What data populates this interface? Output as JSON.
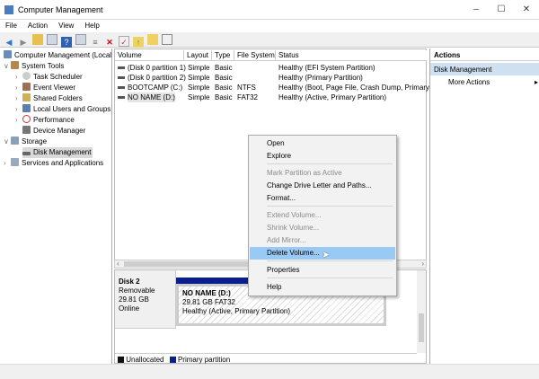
{
  "window": {
    "title": "Computer Management"
  },
  "menu": [
    "File",
    "Action",
    "View",
    "Help"
  ],
  "tree": [
    {
      "label": "Computer Management (Local",
      "level": 0
    },
    {
      "label": "System Tools",
      "level": 1,
      "expanded": true
    },
    {
      "label": "Task Scheduler",
      "level": 2
    },
    {
      "label": "Event Viewer",
      "level": 2
    },
    {
      "label": "Shared Folders",
      "level": 2
    },
    {
      "label": "Local Users and Groups",
      "level": 2
    },
    {
      "label": "Performance",
      "level": 2
    },
    {
      "label": "Device Manager",
      "level": 2
    },
    {
      "label": "Storage",
      "level": 1,
      "expanded": true
    },
    {
      "label": "Disk Management",
      "level": 2,
      "selected": true
    },
    {
      "label": "Services and Applications",
      "level": 1
    }
  ],
  "volumes": {
    "headers": [
      "Volume",
      "Layout",
      "Type",
      "File System",
      "Status"
    ],
    "rows": [
      [
        "(Disk 0 partition 1)",
        "Simple",
        "Basic",
        "",
        "Healthy (EFI System Partition)"
      ],
      [
        "(Disk 0 partition 2)",
        "Simple",
        "Basic",
        "",
        "Healthy (Primary Partition)"
      ],
      [
        "BOOTCAMP (C:)",
        "Simple",
        "Basic",
        "NTFS",
        "Healthy (Boot, Page File, Crash Dump, Primary P"
      ],
      [
        "NO NAME (D:)",
        "Simple",
        "Basic",
        "FAT32",
        "Healthy (Active, Primary Partition)"
      ]
    ]
  },
  "disk": {
    "name": "Disk 2",
    "type": "Removable",
    "size": "29.81 GB",
    "state": "Online",
    "partition": {
      "name": "NO NAME  (D:)",
      "detail": "29.81 GB FAT32",
      "status": "Healthy (Active, Primary Partition)"
    }
  },
  "legend": [
    {
      "label": "Unallocated",
      "color": "#111111"
    },
    {
      "label": "Primary partition",
      "color": "#0a1f8f"
    }
  ],
  "actions": {
    "title": "Actions",
    "section": "Disk Management",
    "items": [
      "More Actions"
    ]
  },
  "context_menu": [
    {
      "label": "Open"
    },
    {
      "label": "Explore"
    },
    {
      "label": "Mark Partition as Active",
      "disabled": true
    },
    {
      "label": "Change Drive Letter and Paths..."
    },
    {
      "label": "Format..."
    },
    {
      "label": "Extend Volume...",
      "disabled": true
    },
    {
      "label": "Shrink Volume...",
      "disabled": true
    },
    {
      "label": "Add Mirror...",
      "disabled": true
    },
    {
      "label": "Delete Volume...",
      "highlighted": true
    },
    {
      "label": "Properties"
    },
    {
      "label": "Help"
    }
  ]
}
